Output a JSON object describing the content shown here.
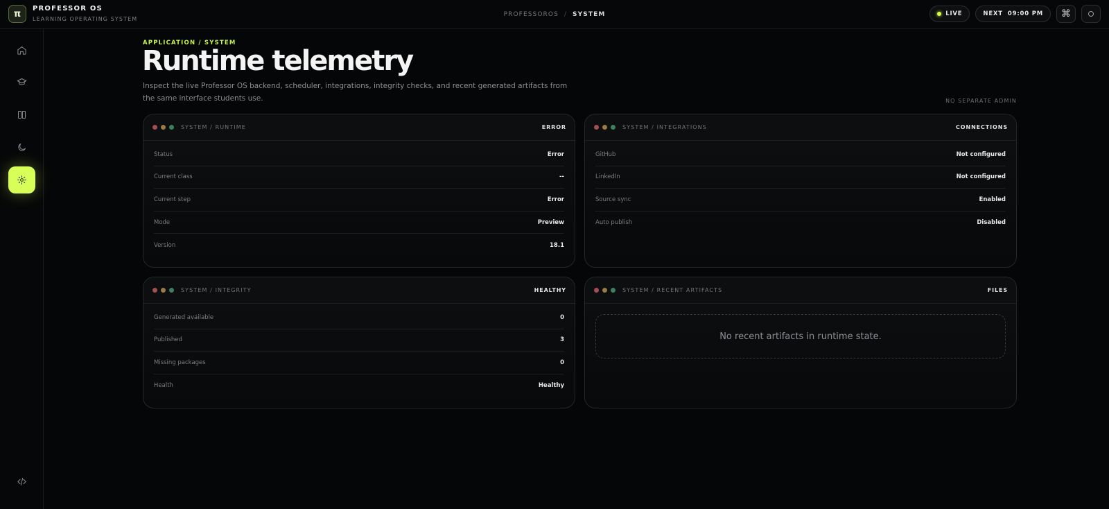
{
  "brand": {
    "logo": "π",
    "name": "PROFESSOR OS",
    "subtitle": "LEARNING OPERATING SYSTEM"
  },
  "breadcrumb": {
    "root": "PROFESSOROS",
    "separator": "/",
    "current": "SYSTEM"
  },
  "top_actions": {
    "live_label": "LIVE",
    "next_label": "NEXT",
    "next_time": "09:00 PM",
    "command_icon": "command-icon",
    "theme_icon": "circle-icon"
  },
  "rail": {
    "items": [
      {
        "icon": "home-icon",
        "active": false
      },
      {
        "icon": "graduation-cap-icon",
        "active": false
      },
      {
        "icon": "book-icon",
        "active": false
      },
      {
        "icon": "moon-icon",
        "active": false
      },
      {
        "icon": "gear-icon",
        "active": true
      }
    ],
    "bottom_icon": "code-icon"
  },
  "header": {
    "eyebrow": "APPLICATION / SYSTEM",
    "title": "Runtime telemetry",
    "description": "Inspect the live Professor OS backend, scheduler, integrations, integrity checks, and recent generated artifacts from the same interface students use.",
    "note": "NO SEPARATE ADMIN"
  },
  "panels": {
    "runtime": {
      "title": "SYSTEM / RUNTIME",
      "tag": "ERROR",
      "rows": [
        {
          "label": "Status",
          "value": "Error"
        },
        {
          "label": "Current class",
          "value": "--"
        },
        {
          "label": "Current step",
          "value": "Error"
        },
        {
          "label": "Mode",
          "value": "Preview"
        },
        {
          "label": "Version",
          "value": "18.1"
        }
      ]
    },
    "integrations": {
      "title": "SYSTEM / INTEGRATIONS",
      "tag": "CONNECTIONS",
      "rows": [
        {
          "label": "GitHub",
          "value": "Not configured"
        },
        {
          "label": "LinkedIn",
          "value": "Not configured"
        },
        {
          "label": "Source sync",
          "value": "Enabled"
        },
        {
          "label": "Auto publish",
          "value": "Disabled"
        }
      ]
    },
    "integrity": {
      "title": "SYSTEM / INTEGRITY",
      "tag": "HEALTHY",
      "rows": [
        {
          "label": "Generated available",
          "value": "0"
        },
        {
          "label": "Published",
          "value": "3"
        },
        {
          "label": "Missing packages",
          "value": "0"
        },
        {
          "label": "Health",
          "value": "Healthy"
        }
      ]
    },
    "artifacts": {
      "title": "SYSTEM / RECENT ARTIFACTS",
      "tag": "FILES",
      "empty_message": "No recent artifacts in runtime state."
    }
  },
  "colors": {
    "accent": "#d8ff57",
    "background": "#050607"
  }
}
